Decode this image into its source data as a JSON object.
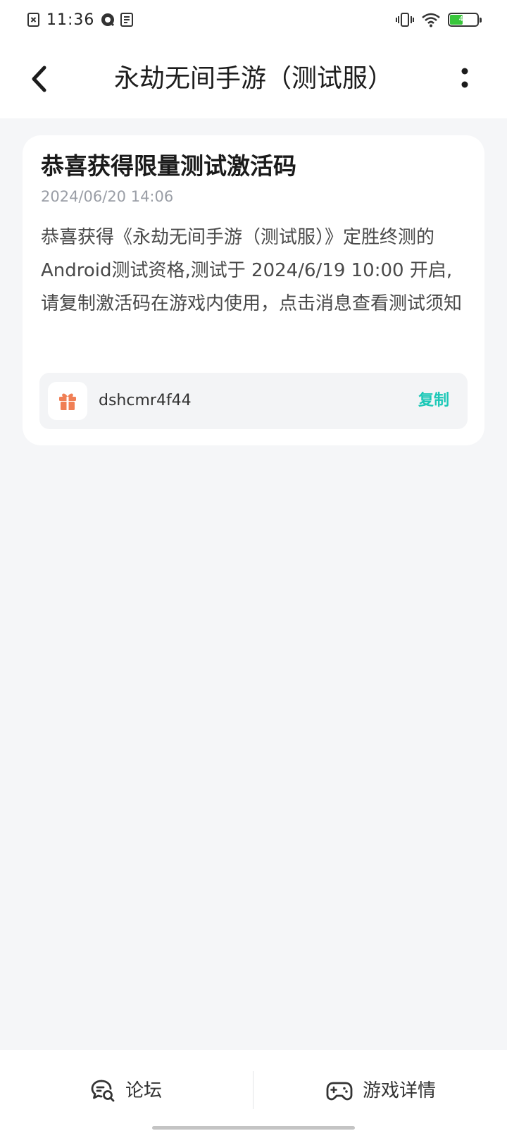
{
  "status_bar": {
    "time": "11:36",
    "battery_level": 49,
    "battery_text": "49",
    "battery_color": "#39c63b",
    "icons_left": [
      "notification-icon",
      "browser-icon",
      "document-icon"
    ],
    "icons_right": [
      "vibrate-icon",
      "wifi-icon",
      "battery-icon"
    ]
  },
  "header": {
    "title": "永劫无间手游（测试服）",
    "back_icon": "chevron-left-icon",
    "more_icon": "more-vertical-icon"
  },
  "message": {
    "title": "恭喜获得限量测试激活码",
    "time": "2024/06/20 14:06",
    "body": "恭喜获得《永劫无间手游（测试服）》定胜终测的Android测试资格,测试于 2024/6/19 10:00 开启,请复制激活码在游戏内使用，点击消息查看测试须知",
    "code": "dshcmr4f44",
    "copy_label": "复制",
    "gift_icon": "gift-icon",
    "gift_color": "#f07f55",
    "accent_color": "#1cc8b7"
  },
  "bottom_nav": {
    "forum_label": "论坛",
    "forum_icon": "chat-search-icon",
    "game_label": "游戏详情",
    "game_icon": "gamepad-icon"
  }
}
